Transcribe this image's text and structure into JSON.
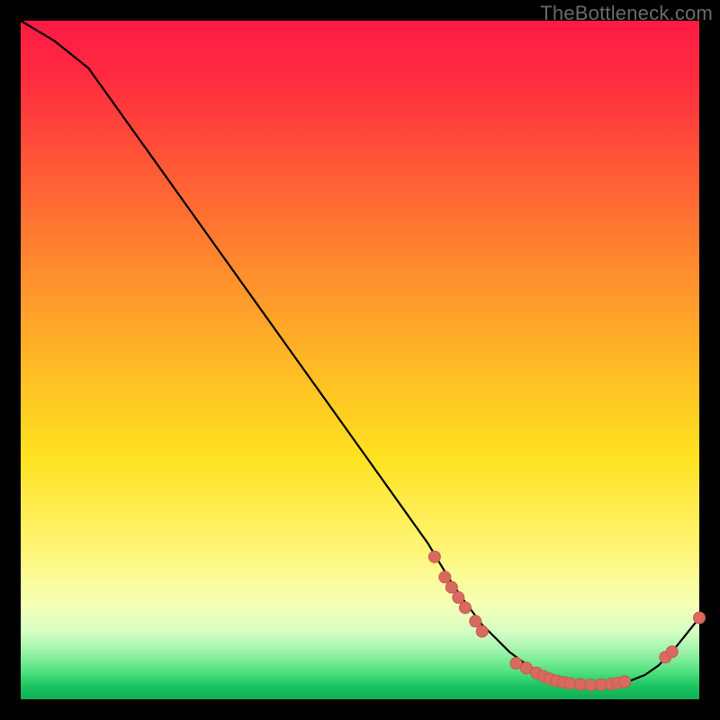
{
  "watermark": "TheBottleneck.com",
  "colors": {
    "curve_stroke": "#000000",
    "marker_fill": "#d86a5f",
    "marker_stroke": "#c85a50"
  },
  "chart_data": {
    "type": "line",
    "title": "",
    "xlabel": "",
    "ylabel": "",
    "xlim": [
      0,
      100
    ],
    "ylim": [
      0,
      100
    ],
    "x": [
      0,
      5,
      10,
      15,
      20,
      25,
      30,
      35,
      40,
      45,
      50,
      55,
      60,
      63,
      65,
      68,
      70,
      72,
      74,
      76,
      78,
      80,
      82,
      84,
      86,
      88,
      90,
      92,
      94,
      96,
      98,
      100
    ],
    "values": [
      100,
      97,
      93,
      86,
      79,
      72,
      65,
      58,
      51,
      44,
      37,
      30,
      23,
      18,
      15,
      11,
      9,
      7,
      5.5,
      4.2,
      3.3,
      2.7,
      2.3,
      2.1,
      2.1,
      2.3,
      2.8,
      3.6,
      5.0,
      7.0,
      9.5,
      12
    ],
    "markers": [
      {
        "x": 61,
        "y": 21
      },
      {
        "x": 62.5,
        "y": 18
      },
      {
        "x": 63.5,
        "y": 16.5
      },
      {
        "x": 64.5,
        "y": 15
      },
      {
        "x": 65.5,
        "y": 13.5
      },
      {
        "x": 67,
        "y": 11.5
      },
      {
        "x": 68,
        "y": 10
      },
      {
        "x": 73,
        "y": 5.3
      },
      {
        "x": 74.5,
        "y": 4.6
      },
      {
        "x": 76,
        "y": 3.9
      },
      {
        "x": 77,
        "y": 3.4
      },
      {
        "x": 78,
        "y": 3.0
      },
      {
        "x": 79,
        "y": 2.7
      },
      {
        "x": 80,
        "y": 2.5
      },
      {
        "x": 81,
        "y": 2.35
      },
      {
        "x": 82.5,
        "y": 2.2
      },
      {
        "x": 84,
        "y": 2.1
      },
      {
        "x": 85.5,
        "y": 2.15
      },
      {
        "x": 87,
        "y": 2.25
      },
      {
        "x": 88,
        "y": 2.4
      },
      {
        "x": 89,
        "y": 2.6
      },
      {
        "x": 95,
        "y": 6.2
      },
      {
        "x": 96,
        "y": 7.0
      },
      {
        "x": 100,
        "y": 12
      }
    ],
    "legend": null,
    "grid": false
  }
}
